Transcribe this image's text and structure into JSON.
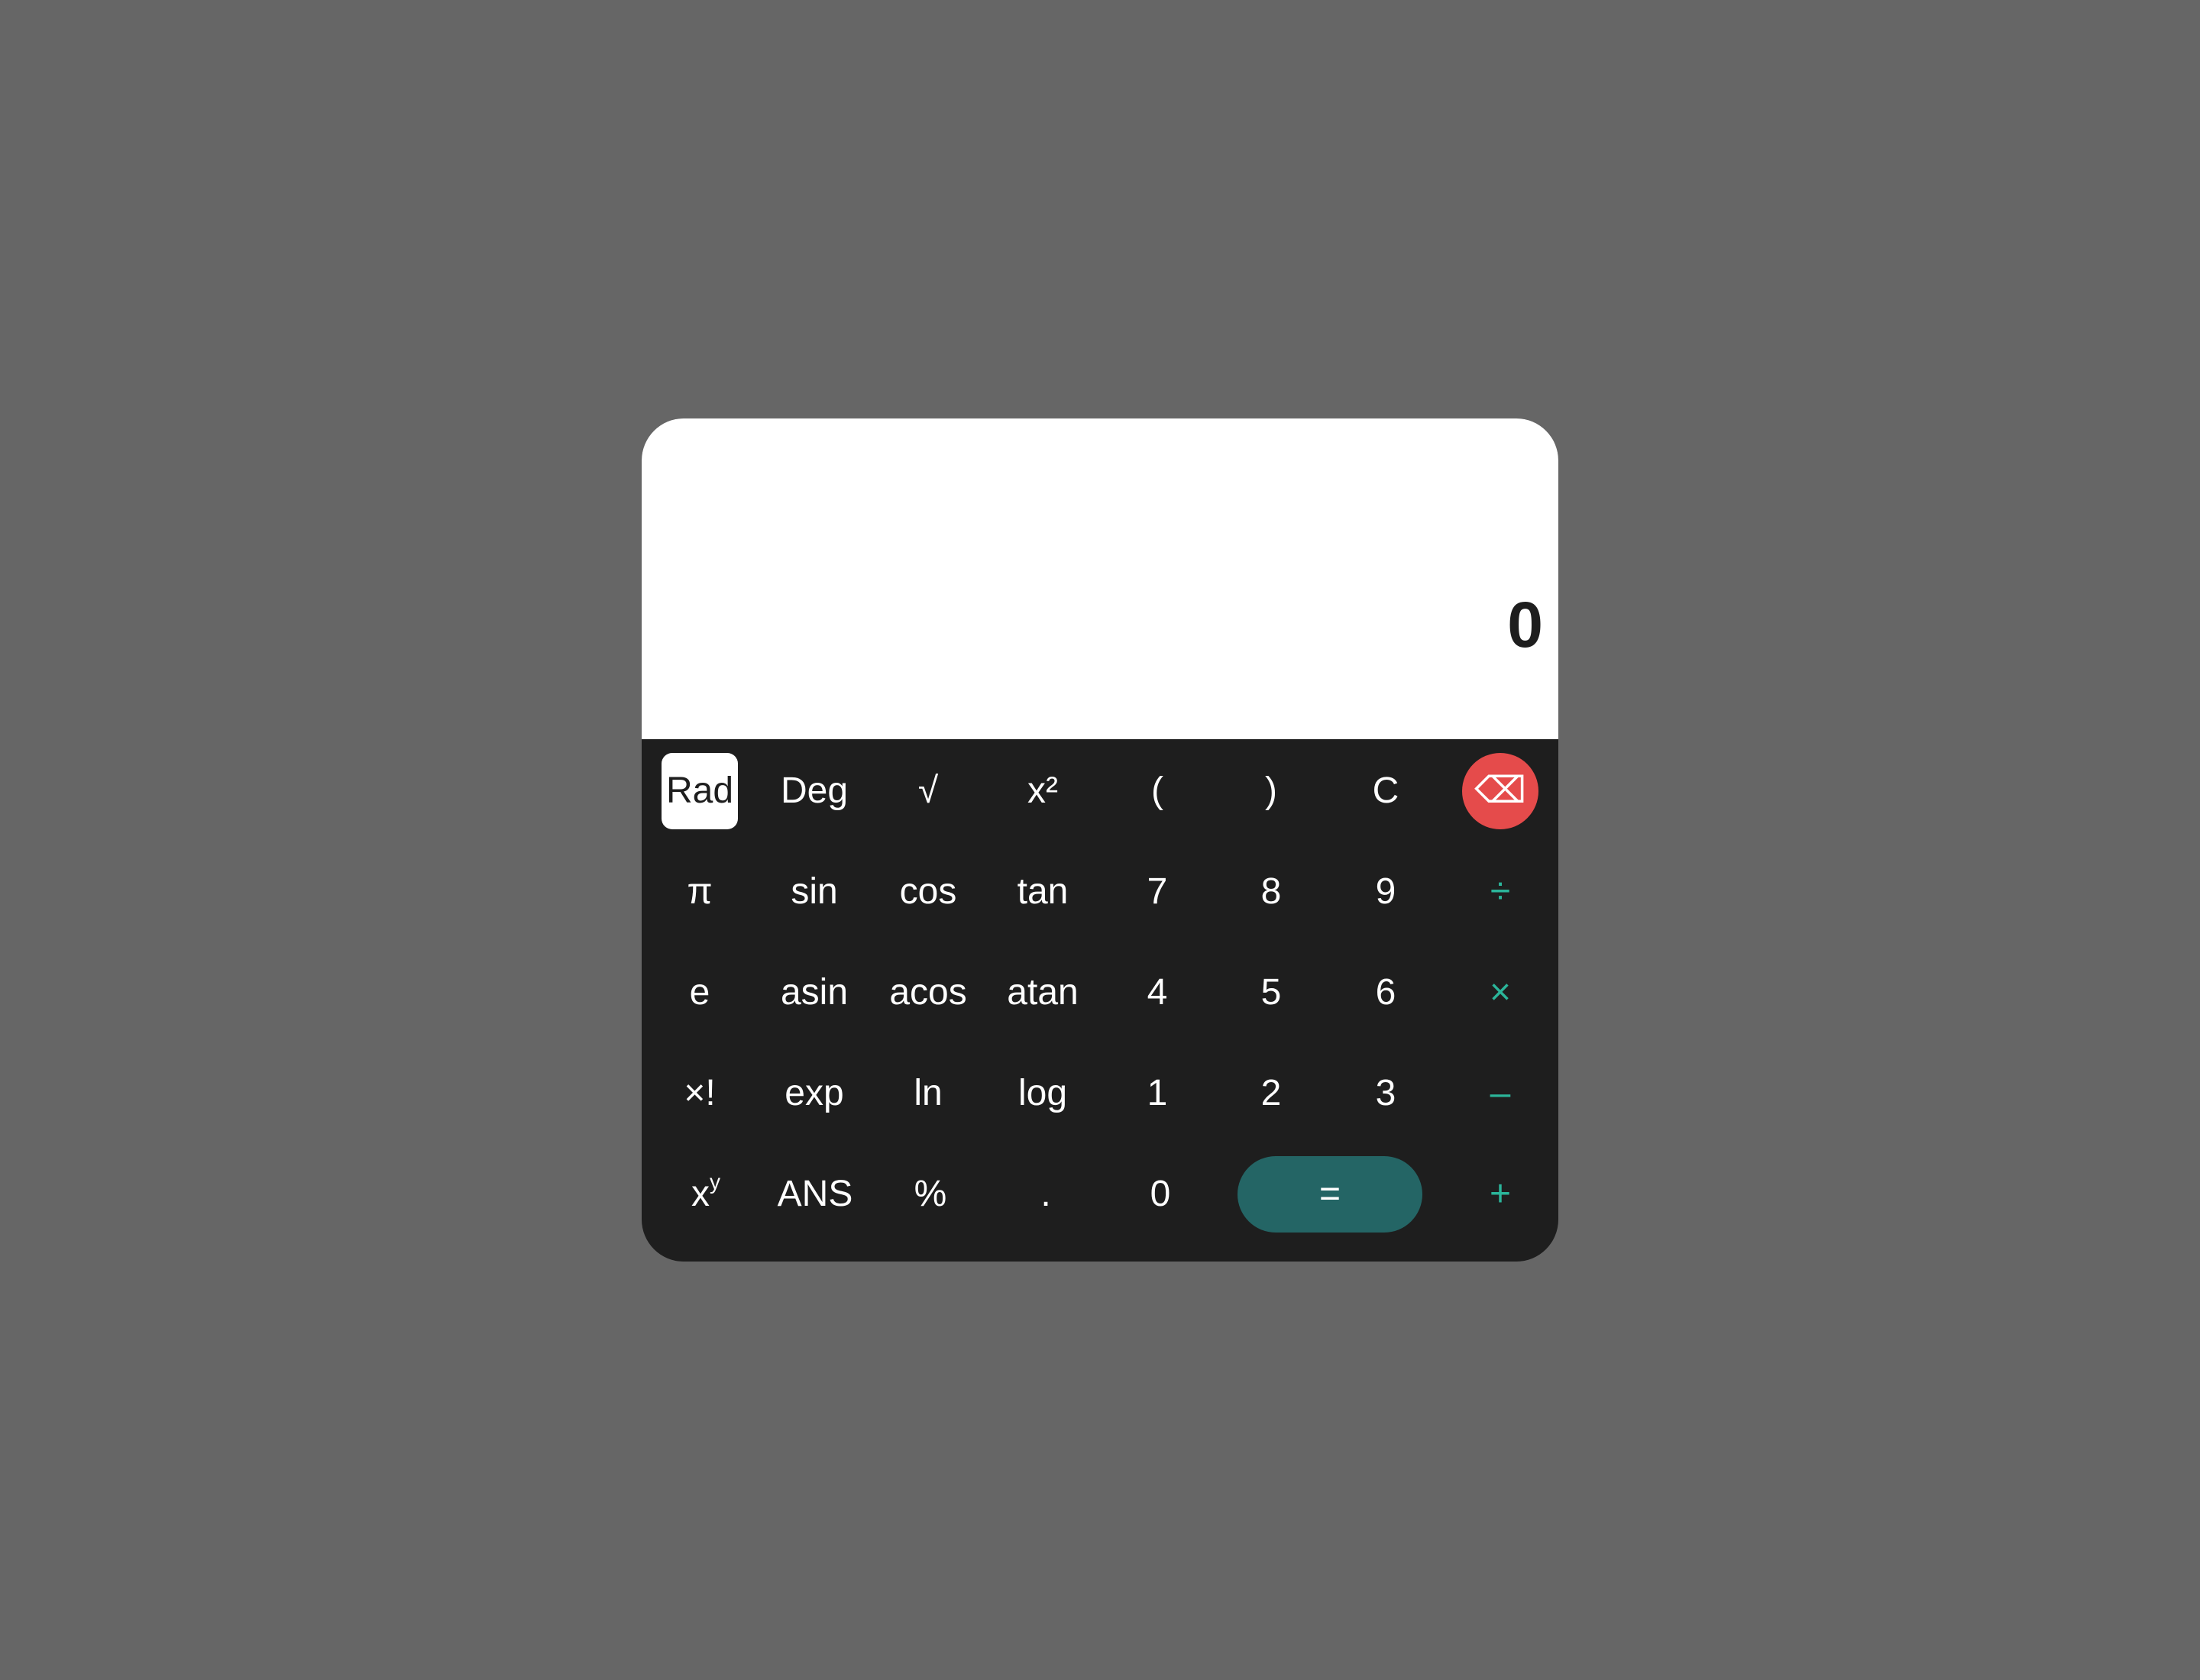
{
  "display": {
    "value": "0"
  },
  "keys": {
    "rad": "Rad",
    "deg": "Deg",
    "sqrt": "√",
    "square": "x²",
    "lparen": "(",
    "rparen": ")",
    "clear": "C",
    "backspace": "⌫",
    "pi": "π",
    "sin": "sin",
    "cos": "cos",
    "tan": "tan",
    "seven": "7",
    "eight": "8",
    "nine": "9",
    "divide": "÷",
    "e": "e",
    "asin": "asin",
    "acos": "acos",
    "atan": "atan",
    "four": "4",
    "five": "5",
    "six": "6",
    "multiply": "×",
    "factorial": "×!",
    "exp": "exp",
    "ln": "ln",
    "log": "log",
    "one": "1",
    "two": "2",
    "three": "3",
    "minus": "–",
    "power_base": "x",
    "power_exp": "y",
    "ans": "ANS",
    "percent": "%",
    "decimal": ".",
    "zero": "0",
    "equals": "=",
    "plus": "+"
  },
  "colors": {
    "background": "#666666",
    "keypad": "#1e1e1e",
    "display": "#ffffff",
    "operator": "#2bb59a",
    "backspace": "#e54b4b",
    "equals": "#246565",
    "active_mode": "#ffffff"
  },
  "state": {
    "angle_mode": "Rad"
  }
}
